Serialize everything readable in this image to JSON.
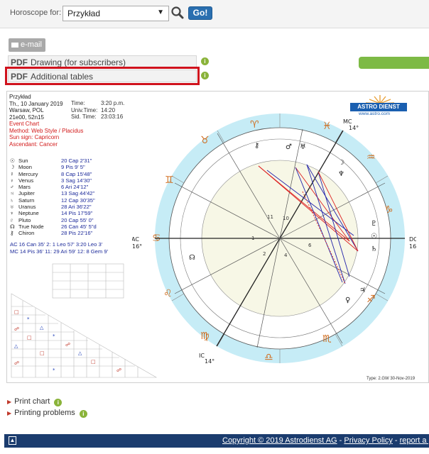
{
  "header": {
    "label": "Horoscope for:",
    "selected": "Przykład",
    "go_label": "Go!"
  },
  "actions": {
    "email_label": "e-mail"
  },
  "pdf_options": [
    {
      "tag": "PDF",
      "label": "Drawing (for subscribers)"
    },
    {
      "tag": "PDF",
      "label": "Additional tables"
    }
  ],
  "chart_info": {
    "name": "Przykład",
    "date": "Th., 10 January 2019",
    "place": "Warsaw, POL",
    "coords": "21e00, 52n15",
    "time_label": "Time:",
    "time": "3:20 p.m.",
    "univ_label": "Univ.Time:",
    "univ": "14:20",
    "sid_label": "Sid. Time:",
    "sid": "23:03:16",
    "type_lines": [
      "Event Chart",
      "Method: Web Style / Placidus",
      "Sun sign: Capricorn",
      "Ascendant: Cancer"
    ]
  },
  "planets": [
    {
      "sym": "☉",
      "name": "Sun",
      "pos": "20 Cap  2'31\""
    },
    {
      "sym": "☽",
      "name": "Moon",
      "pos": "9 Pis  9' 5\""
    },
    {
      "sym": "☿",
      "name": "Mercury",
      "pos": "8 Cap 15'48\""
    },
    {
      "sym": "♀",
      "name": "Venus",
      "pos": "3 Sag 14'30\""
    },
    {
      "sym": "♂",
      "name": "Mars",
      "pos": "6 Ari 24'12\""
    },
    {
      "sym": "♃",
      "name": "Jupiter",
      "pos": "13 Sag 44'42\""
    },
    {
      "sym": "♄",
      "name": "Saturn",
      "pos": "12 Cap 30'35\""
    },
    {
      "sym": "♅",
      "name": "Uranus",
      "pos": "28 Ari 36'22\""
    },
    {
      "sym": "♆",
      "name": "Neptune",
      "pos": "14 Pis 17'59\""
    },
    {
      "sym": "♇",
      "name": "Pluto",
      "pos": "20 Cap 55' 0\""
    },
    {
      "sym": "☊",
      "name": "True Node",
      "pos": "26 Can 45' 5\"d"
    },
    {
      "sym": "⚷",
      "name": "Chiron",
      "pos": "28 Pis 22'16\""
    }
  ],
  "houses": [
    "AC 16 Can 35'   2:  1 Leo 57'   3:20 Leo  3'",
    "MC 14 Pis 36'  11: 29 Ari 59'  12:  8 Gem  9'"
  ],
  "wheel_labels": {
    "ac": "AC",
    "ac_deg": "16°",
    "dc": "DC",
    "dc_deg": "16°",
    "mc": "MC",
    "mc_deg": "14°",
    "ic": "IC",
    "ic_deg": "14°"
  },
  "logo": {
    "name": "ASTRO DIENST",
    "url": "www.astro.com"
  },
  "type_footer": "Type: 2.GW  30-Nov-2019",
  "links": [
    {
      "label": "Print chart"
    },
    {
      "label": "Printing problems"
    }
  ],
  "footer": {
    "copyright": "Copyright © 2019 Astrodienst AG",
    "privacy": "Privacy Policy",
    "report": "report a pr"
  },
  "colors": {
    "accent": "#2a6fb0",
    "highlight": "#d0121d",
    "footer": "#1b3c6e",
    "ring": "#c6ecf6"
  }
}
